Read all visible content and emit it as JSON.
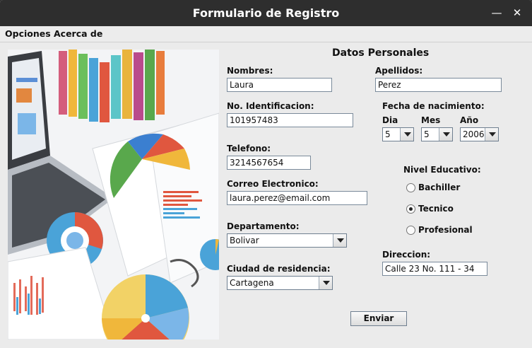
{
  "window": {
    "title": "Formulario de Registro"
  },
  "menu": {
    "items": [
      "Opciones",
      "Acerca de"
    ]
  },
  "form": {
    "section_title": "Datos Personales",
    "nombres": {
      "label": "Nombres:",
      "value": "Laura"
    },
    "apellidos": {
      "label": "Apellidos:",
      "value": "Perez"
    },
    "identificacion": {
      "label": "No. Identificacion:",
      "value": "101957483"
    },
    "fecha": {
      "label": "Fecha de nacimiento:",
      "dia": {
        "label": "Dia",
        "value": "5"
      },
      "mes": {
        "label": "Mes",
        "value": "5"
      },
      "anio": {
        "label": "Año",
        "value": "2006"
      }
    },
    "telefono": {
      "label": "Telefono:",
      "value": "3214567654"
    },
    "correo": {
      "label": "Correo Electronico:",
      "value": "laura.perez@email.com"
    },
    "nivel": {
      "label": "Nivel Educativo:",
      "options": [
        {
          "label": "Bachiller",
          "checked": false
        },
        {
          "label": "Tecnico",
          "checked": true
        },
        {
          "label": "Profesional",
          "checked": false
        }
      ]
    },
    "departamento": {
      "label": "Departamento:",
      "value": "Bolivar"
    },
    "direccion": {
      "label": "Direccion:",
      "value": "Calle 23 No. 111 - 34"
    },
    "ciudad": {
      "label": "Ciudad de residencia:",
      "value": "Cartagena"
    },
    "submit_label": "Enviar"
  },
  "colors": {
    "titlebar": "#2e2e2e",
    "window_bg": "#ebebeb",
    "field_border": "#7a8a9a"
  },
  "icons": {
    "minimize": "minimize-icon",
    "close": "close-icon",
    "illustration": "analytics-illustration"
  }
}
